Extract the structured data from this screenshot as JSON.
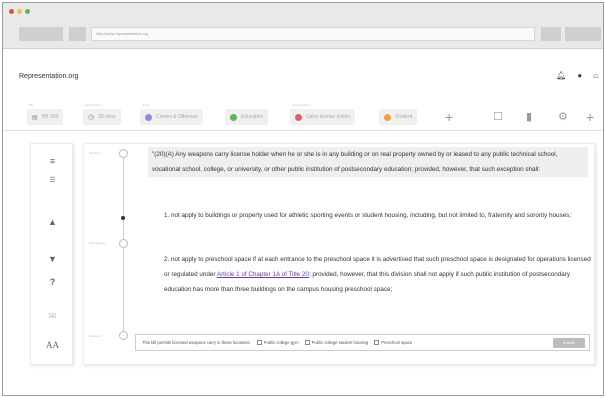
{
  "browser": {
    "url": "http://www.representation.org",
    "colors": {
      "close": "#e74c3c",
      "minimize": "#f5c040",
      "maximize": "#5cb85c"
    }
  },
  "app": {
    "title": "Representation.org",
    "header_icons": [
      "bell-icon",
      "user-icon",
      "home-icon"
    ]
  },
  "tags": [
    {
      "label": "Bill",
      "text": "HB 280",
      "icon": "tag-icon"
    },
    {
      "label": "Est Duration",
      "text": "30 mins",
      "icon": "clock-icon"
    },
    {
      "label": "Topic",
      "text": "Crimes & Offenses",
      "color": "#8e8ed8"
    },
    {
      "label": "",
      "text": "Education",
      "color": "#5cb85c"
    },
    {
      "label": "Stakeholders",
      "text": "Carry license holder",
      "color": "#e06070"
    },
    {
      "label": "",
      "text": "Student",
      "color": "#f0a040"
    }
  ],
  "toolbar": {
    "icons": [
      "add-icon",
      "bookmark-icon",
      "trash-icon",
      "settings-icon",
      "add-icon"
    ]
  },
  "sidebar_icons": [
    "list-icon",
    "outline-icon",
    "thumbs-up-icon",
    "thumbs-down-icon",
    "help-icon",
    "message-icon",
    "font-size-icon"
  ],
  "bill": {
    "sections": [
      "Section 1",
      "Discussion 1",
      "Section 2"
    ],
    "para1": "\"(20)(A) Any weapons carry license holder when he or she is in any building or on real property owned by or leased to any public technical school, vocational school, college, or university, or other public institution of postsecondary education; provided, however, that such exception shall:",
    "para2": "1. not apply to buildings or property used for athletic sporting events or student  housing, including, but not limited to, fraternity and sorority houses;",
    "para3_before": "2. not apply to preschool space if at each entrance to the preschool space it is advertised that such preschool space is designated for operations licensed or regulated under ",
    "para3_link": "Article 1 of Chapter 1A of Title 20",
    "para3_after": "; provided, however, that this division shall not apply if such public institution of postsecondary education has more than three buildings on the campus housing preschool space;"
  },
  "poll": {
    "prompt": "This bill permits licensed weapons carry in these locations:",
    "options": [
      "Public college gym",
      "Public college student housing",
      "Preschool space"
    ],
    "submit": "Submit"
  }
}
